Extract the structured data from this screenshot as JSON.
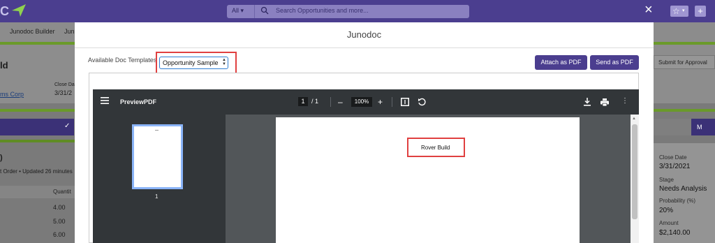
{
  "app": {
    "logo_text": "C",
    "search_scope": "All",
    "search_placeholder": "Search Opportunities and more...",
    "close_label": "×",
    "nav_items": [
      "Junodoc Builder",
      "Jun"
    ],
    "record_title": "ld",
    "account_link": "ms Corp",
    "close_date_label": "Close Da",
    "close_date_value": "3/31/2",
    "submit_button": "Submit for Approval",
    "m_button": "M",
    "related_title": ")",
    "related_subtitle": "t Order • Updated 26 minutes",
    "qty_header": "Quantit",
    "qty_values": [
      "4.00",
      "5.00",
      "6.00"
    ],
    "details": [
      {
        "label": "Close Date",
        "value": "3/31/2021"
      },
      {
        "label": "Stage",
        "value": "Needs Analysis"
      },
      {
        "label": "Probability (%)",
        "value": "20%"
      },
      {
        "label": "Amount",
        "value": "$2,140.00"
      }
    ]
  },
  "modal": {
    "title": "Junodoc",
    "template_label": "Available Doc Templates",
    "template_selected": "Opportunity Sample",
    "attach_button": "Attach as PDF",
    "send_button": "Send as PDF"
  },
  "pdf": {
    "title": "PreviewPDF",
    "page_current": "1",
    "page_total": "/ 1",
    "zoom": "100%",
    "thumb_page": "1",
    "page_content": "Rover Build"
  },
  "colors": {
    "brand": "#4b3e8f",
    "highlight": "#e04040",
    "pdf_toolbar": "#323639"
  }
}
